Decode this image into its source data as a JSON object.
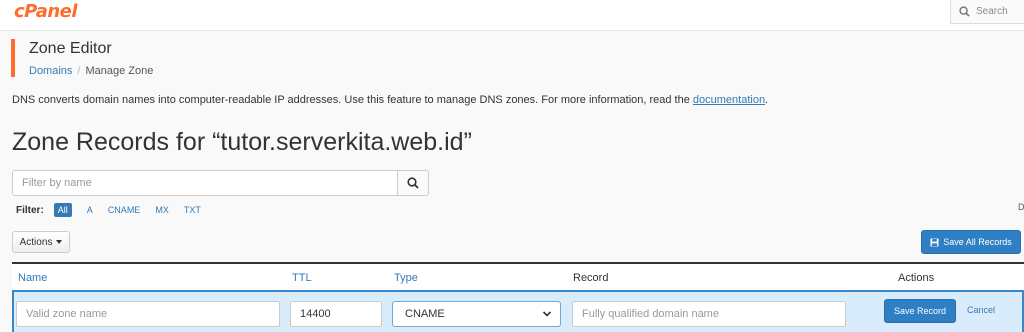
{
  "brand": {
    "logo": "cPanel",
    "accent": "#ff6c2c"
  },
  "search": {
    "placeholder": "Search"
  },
  "header": {
    "title": "Zone Editor"
  },
  "breadcrumb": {
    "items": [
      "Domains",
      "Manage Zone"
    ]
  },
  "intro": {
    "text": "DNS converts domain names into computer-readable IP addresses. Use this feature to manage DNS zones. For more information, read the ",
    "link": "documentation",
    "suffix": "."
  },
  "zone": {
    "title": "Zone Records for “tutor.serverkita.web.id”"
  },
  "filter": {
    "placeholder": "Filter by name",
    "label": "Filter:",
    "options": [
      "All",
      "A",
      "CNAME",
      "MX",
      "TXT"
    ],
    "selected": "All",
    "overflow_letter": "D"
  },
  "toolbar": {
    "actions_label": "Actions",
    "save_all_label": "Save All Records"
  },
  "table": {
    "columns": [
      "Name",
      "TTL",
      "Type",
      "Record",
      "Actions"
    ]
  },
  "edit_row": {
    "name_placeholder": "Valid zone name",
    "ttl_value": "14400",
    "type_value": "CNAME",
    "record_placeholder": "Fully qualified domain name",
    "save_label": "Save Record",
    "cancel_label": "Cancel"
  },
  "colors": {
    "link": "#337ab7",
    "primary_button": "#2f7fc4",
    "edit_row_bg": "#d9ecfb"
  }
}
